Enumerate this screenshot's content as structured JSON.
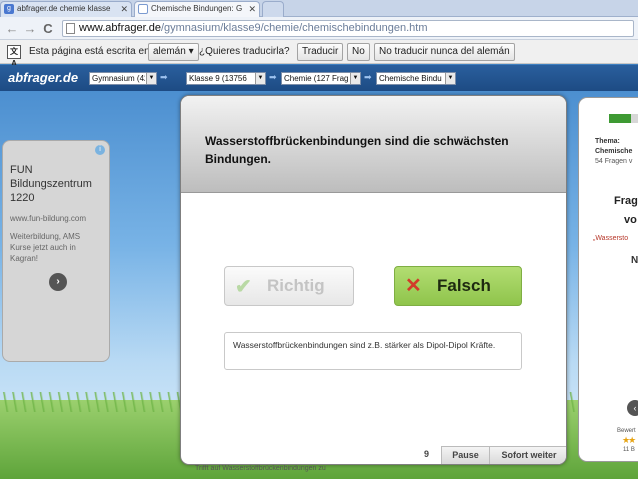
{
  "browser": {
    "tabs": [
      {
        "title": "abfrager.de chemie klasse",
        "favicon": "g",
        "active": false
      },
      {
        "title": "Chemische Bindungen: G",
        "active": true
      },
      {
        "title": ""
      }
    ],
    "close_glyph": "✕",
    "back_glyph": "←",
    "forward_glyph": "→",
    "reload_glyph": "C",
    "url_host": "www.abfrager.de",
    "url_path": "/gymnasium/klasse9/chemie/chemischebindungen.htm"
  },
  "translate": {
    "icon_text": "文A",
    "prefix": "Esta página está escrita en",
    "language": "alemán ▾",
    "question": "¿Quieres traducirla?",
    "translate_button": "Traducir",
    "no_button": "No",
    "never_button": "No traducir nunca del alemán"
  },
  "site": {
    "logo": "abfrager.de",
    "arrow_glyph": "➡",
    "breadcrumbs": [
      {
        "label": "Gymnasium (422",
        "dd": "▼"
      },
      {
        "label": "Klasse 9 (13756",
        "dd": "▼"
      },
      {
        "label": "Chemie (127 Frag",
        "dd": "▼"
      },
      {
        "label": "Chemische Bindu",
        "dd": "▼"
      }
    ]
  },
  "ad": {
    "adchoice": "i",
    "title": "FUN Bildungszentrum 1220",
    "url": "www.fun-bildung.com",
    "text": "Weiterbildung, AMS Kurse jetzt auch in Kagran!",
    "arrow": "›"
  },
  "quiz": {
    "question": "Wasserstoffbrückenbindungen sind die schwächsten Bindungen.",
    "richtig_icon": "✔",
    "richtig_label": "Richtig",
    "falsch_icon": "✕",
    "falsch_label": "Falsch",
    "explanation": "Wasserstoffbrückenbindungen sind z.B. stärker als Dipol-Dipol Kräfte.",
    "number": "9",
    "pause_label": "Pause",
    "sofort_label": "Sofort weiter"
  },
  "right_panel": {
    "progress_fraction": 0.55,
    "thema_label": "Thema:",
    "topic": "Chemische",
    "count": "54 Fragen v",
    "frag": "Frag",
    "vor": "vo",
    "quote": "„Wassersto",
    "n": "N",
    "circle": "‹",
    "bewertung": "Bewert",
    "stars": "★★",
    "b": "11 B"
  },
  "status": "Trifft auf Wasserstoffbrückenbindungen zu"
}
